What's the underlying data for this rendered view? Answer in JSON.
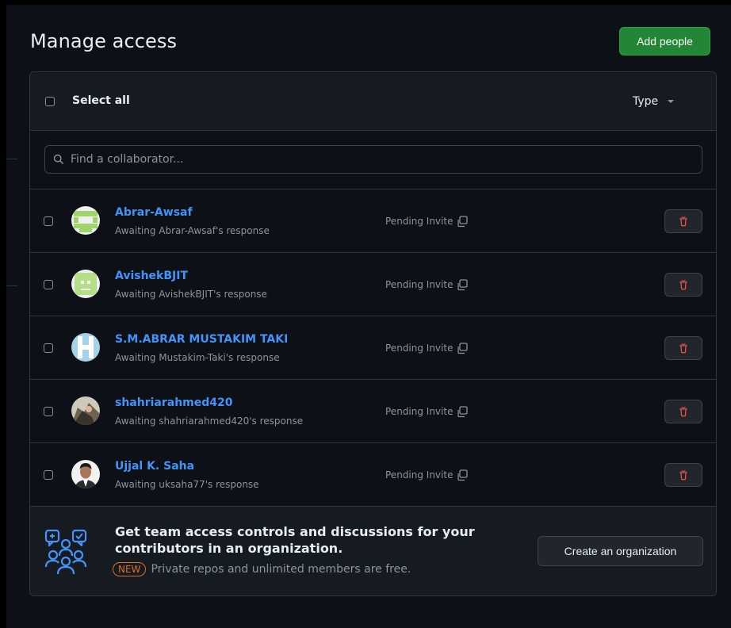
{
  "header": {
    "title": "Manage access",
    "add_people_label": "Add people"
  },
  "toolbar": {
    "select_all_label": "Select all",
    "type_filter_label": "Type"
  },
  "search": {
    "placeholder": "Find a collaborator..."
  },
  "collaborators": [
    {
      "name": "Abrar-Awsaf",
      "status": "Awaiting Abrar-Awsaf's response",
      "role": "Pending Invite",
      "avatar_color": "#b8e986"
    },
    {
      "name": "AvishekBJIT",
      "status": "Awaiting AvishekBJIT's response",
      "role": "Pending Invite",
      "avatar_color": "#c7e7a3"
    },
    {
      "name": "S.M.ABRAR MUSTAKIM TAKI",
      "status": "Awaiting Mustakim-Taki's response",
      "role": "Pending Invite",
      "avatar_color": "#a4d3e8"
    },
    {
      "name": "shahriarahmed420",
      "status": "Awaiting shahriarahmed420's response",
      "role": "Pending Invite",
      "avatar_color": "#8f7f6b"
    },
    {
      "name": "Ujjal K. Saha",
      "status": "Awaiting uksaha77's response",
      "role": "Pending Invite",
      "avatar_color": "#4a4540"
    }
  ],
  "promo": {
    "title": "Get team access controls and discussions for your contributors in an organization.",
    "badge": "NEW",
    "subtitle": "Private repos and unlimited members are free.",
    "create_org_label": "Create an organization"
  },
  "colors": {
    "accent_green": "#238636",
    "link_blue": "#4493f8",
    "danger_red": "#f85149",
    "badge_orange": "#db6d28"
  }
}
